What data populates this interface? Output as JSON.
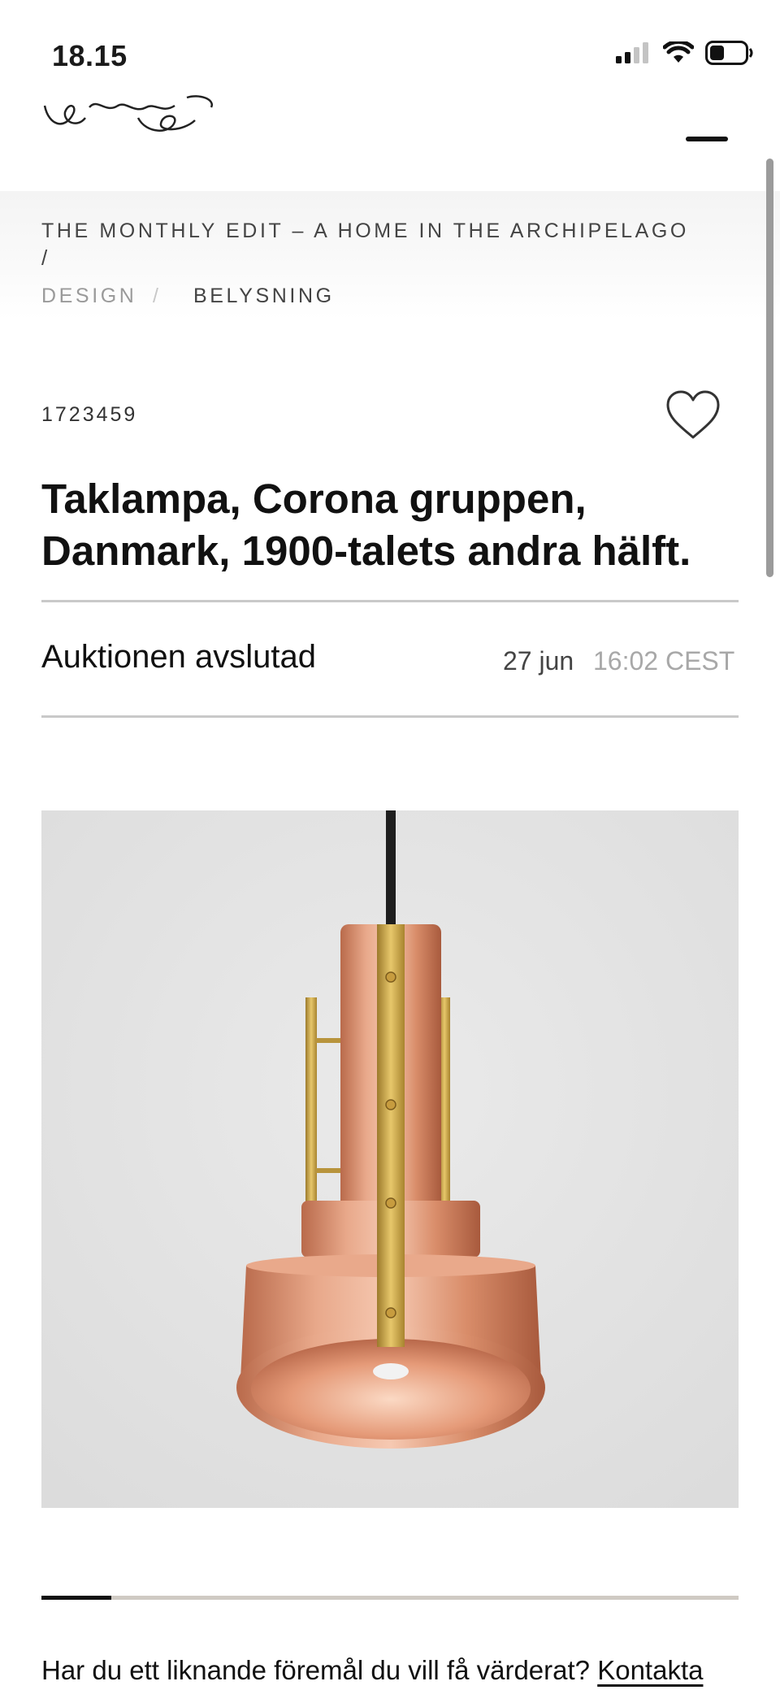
{
  "status_bar": {
    "time": "18.15",
    "icons": [
      "signal-icon",
      "wifi-icon",
      "battery-icon"
    ]
  },
  "header": {
    "logo_icon": "script-logo",
    "menu_icon": "menu-icon"
  },
  "breadcrumb": {
    "edit": "THE MONTHLY EDIT – A HOME IN THE ARCHIPELAGO",
    "separator_1": "/",
    "category": "DESIGN",
    "separator_2": "/",
    "subcategory": "BELYSNING"
  },
  "item": {
    "lot_number": "1723459",
    "favorite_icon": "heart-icon",
    "title": "Taklampa, Corona gruppen, Danmark, 1900-talets andra hälft."
  },
  "auction": {
    "status": "Auktionen avslutad",
    "date": "27 jun",
    "time": "16:02 CEST"
  },
  "gallery": {
    "image_icon": "copper-pendant-lamp-photo",
    "progress": 0.1
  },
  "contact": {
    "question": "Har du ett liknande föremål du vill få värderat?",
    "link_label": "Kontakta"
  },
  "colors": {
    "accent": "#111111",
    "muted": "#9a9a9a",
    "image_background": "#e3e3e3",
    "copper": "#d98d6a",
    "brass": "#c8a24a"
  }
}
